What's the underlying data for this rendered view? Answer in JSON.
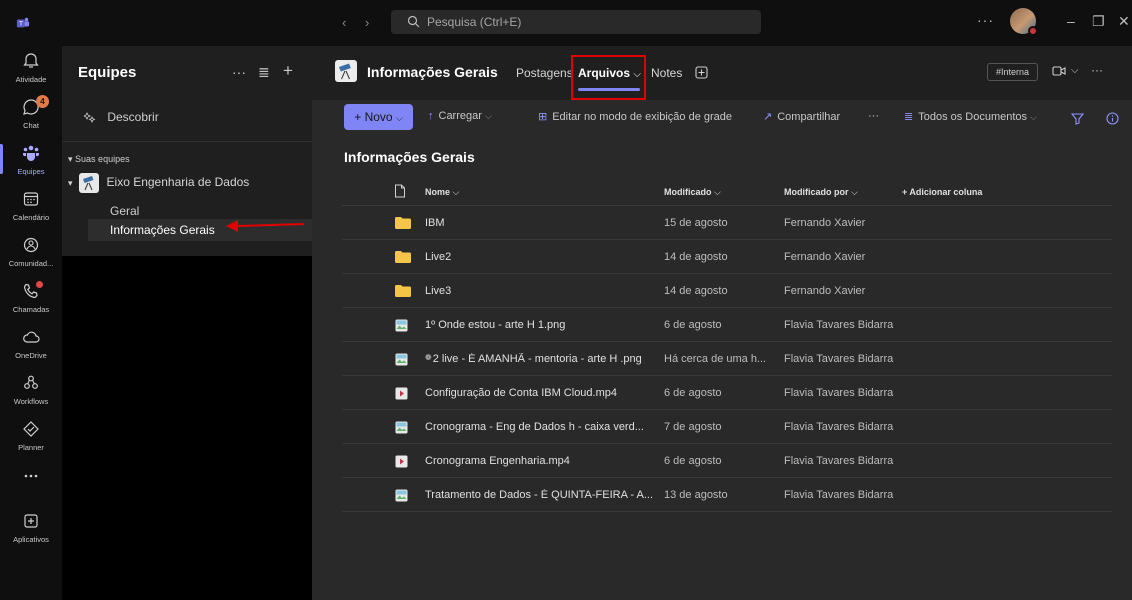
{
  "titlebar": {
    "search_placeholder": "Pesquisa (Ctrl+E)",
    "more_label": "···"
  },
  "rail": [
    {
      "label": "Atividade",
      "icon": "bell-icon"
    },
    {
      "label": "Chat",
      "icon": "chat-icon",
      "badge": "4"
    },
    {
      "label": "Equipes",
      "icon": "teams-icon",
      "active": true
    },
    {
      "label": "Calendário",
      "icon": "calendar-icon"
    },
    {
      "label": "Comunidad...",
      "icon": "community-icon"
    },
    {
      "label": "Chamadas",
      "icon": "phone-icon"
    },
    {
      "label": "OneDrive",
      "icon": "cloud-icon"
    },
    {
      "label": "Workflows",
      "icon": "workflow-icon"
    },
    {
      "label": "Planner",
      "icon": "planner-icon"
    },
    {
      "label": "",
      "icon": "more-icon"
    },
    {
      "label": "Aplicativos",
      "icon": "apps-icon"
    }
  ],
  "teams_panel": {
    "title": "Equipes",
    "discover": "Descobrir",
    "your_teams": "Suas equipes",
    "team_name": "Eixo Engenharia de Dados",
    "channels": [
      "Geral",
      "Informações Gerais"
    ]
  },
  "channel": {
    "title": "Informações Gerais",
    "tabs": {
      "posts": "Postagens",
      "files": "Arquivos",
      "notes": "Notes"
    },
    "tag": "#Interna"
  },
  "commands": {
    "new": "Novo",
    "upload": "Carregar",
    "edit_grid": "Editar no modo de exibição de grade",
    "share": "Compartilhar",
    "more": "···",
    "view": "Todos os Documentos"
  },
  "library_title": "Informações Gerais",
  "table": {
    "headers": {
      "name": "Nome",
      "modified": "Modificado",
      "modified_by": "Modificado por",
      "add_column": "+ Adicionar coluna"
    },
    "rows": [
      {
        "type": "folder",
        "name": "IBM",
        "modified": "15 de agosto",
        "by": "Fernando Xavier"
      },
      {
        "type": "folder",
        "name": "Live2",
        "modified": "14 de agosto",
        "by": "Fernando Xavier"
      },
      {
        "type": "folder",
        "name": "Live3",
        "modified": "14 de agosto",
        "by": "Fernando Xavier"
      },
      {
        "type": "image",
        "name": "1º Onde estou - arte H 1.png",
        "modified": "6 de agosto",
        "by": "Flavia Tavares Bidarra"
      },
      {
        "type": "image",
        "name": "2 live - É AMANHÃ - mentoria - arte H .png",
        "modified": "Há cerca de uma h...",
        "by": "Flavia Tavares Bidarra",
        "new": true
      },
      {
        "type": "video",
        "name": "Configuração de Conta IBM Cloud.mp4",
        "modified": "6 de agosto",
        "by": "Flavia Tavares Bidarra"
      },
      {
        "type": "image",
        "name": "Cronograma - Eng de Dados h - caixa verd...",
        "modified": "7 de agosto",
        "by": "Flavia Tavares Bidarra"
      },
      {
        "type": "video",
        "name": "Cronograma Engenharia.mp4",
        "modified": "6 de agosto",
        "by": "Flavia Tavares Bidarra"
      },
      {
        "type": "image",
        "name": "Tratamento de Dados - É QUINTA-FEIRA - A...",
        "modified": "13 de agosto",
        "by": "Flavia Tavares Bidarra"
      }
    ]
  },
  "colors": {
    "accent": "#7f85f5",
    "highlight": "#e00000",
    "folder": "#f5c54a"
  }
}
